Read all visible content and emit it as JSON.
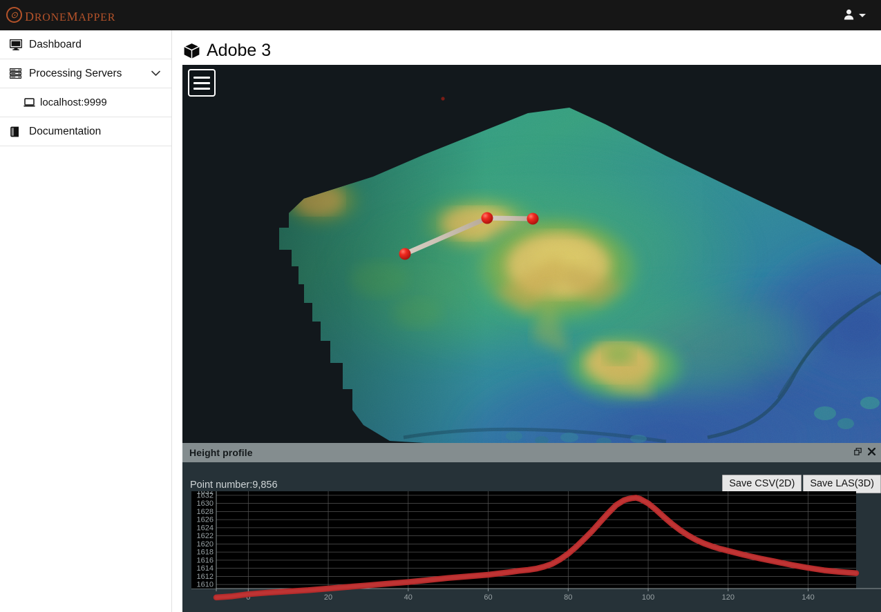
{
  "app": {
    "brand_name": "DroneMapper",
    "brand_color": "#b5532a",
    "logo_icon": "drone-swirl-icon"
  },
  "topbar": {
    "user_icon": "user-icon",
    "caret_icon": "chevron-down-icon"
  },
  "sidebar": {
    "items": [
      {
        "label": "Dashboard",
        "icon": "desktop-monitor-icon",
        "sub": false,
        "chevron": ""
      },
      {
        "label": "Processing Servers",
        "icon": "server-stack-icon",
        "sub": false,
        "chevron": "chevron-down-icon"
      },
      {
        "label": "localhost:9999",
        "icon": "laptop-icon",
        "sub": true,
        "chevron": ""
      },
      {
        "label": "Documentation",
        "icon": "book-icon",
        "sub": false,
        "chevron": ""
      }
    ]
  },
  "main": {
    "page_title": "Adobe 3",
    "page_title_icon": "cube-icon"
  },
  "viewer": {
    "menu_icon": "hamburger-menu-icon",
    "background_color": "#12181c",
    "measurement_marker_color": "#e02020",
    "measurement_markers": 3
  },
  "profile_panel": {
    "title": "Height profile",
    "restore_icon": "restore-window-icon",
    "close_icon": "close-icon",
    "point_number_label": "Point number:9,856",
    "buttons": [
      {
        "label": "Save CSV(2D)",
        "name": "save-csv-2d-button"
      },
      {
        "label": "Save LAS(3D)",
        "name": "save-las-3d-button"
      }
    ]
  },
  "chart_data": {
    "type": "line",
    "title": "Height profile",
    "xlabel": "",
    "ylabel": "",
    "series_color": "#b52b2b",
    "background": "#000000",
    "grid": true,
    "xlim": [
      -8,
      152
    ],
    "ylim": [
      1609,
      1633
    ],
    "xticks": [
      0,
      20,
      40,
      60,
      80,
      100,
      120,
      140
    ],
    "yticks": [
      1610,
      1612,
      1614,
      1616,
      1618,
      1620,
      1622,
      1624,
      1626,
      1628,
      1630,
      1632
    ],
    "x": [
      -8,
      -4,
      0,
      5,
      10,
      15,
      20,
      25,
      30,
      35,
      40,
      45,
      50,
      55,
      60,
      65,
      68,
      70,
      72,
      74,
      76,
      78,
      80,
      82,
      84,
      86,
      88,
      90,
      92,
      94,
      95,
      96,
      97,
      98,
      100,
      102,
      104,
      106,
      108,
      110,
      112,
      114,
      116,
      118,
      120,
      124,
      128,
      132,
      136,
      140,
      144,
      148,
      152
    ],
    "y": [
      1606.8,
      1607.1,
      1607.6,
      1608.0,
      1608.3,
      1608.6,
      1609.0,
      1609.4,
      1609.8,
      1610.2,
      1610.6,
      1611.1,
      1611.6,
      1612.0,
      1612.4,
      1613.0,
      1613.4,
      1613.6,
      1613.9,
      1614.4,
      1615.1,
      1616.2,
      1617.6,
      1619.3,
      1621.2,
      1623.2,
      1625.4,
      1627.6,
      1629.6,
      1630.8,
      1631.1,
      1631.3,
      1631.4,
      1631.1,
      1630.0,
      1628.4,
      1626.6,
      1624.9,
      1623.4,
      1622.1,
      1621.0,
      1620.1,
      1619.4,
      1618.8,
      1618.3,
      1617.3,
      1616.4,
      1615.6,
      1614.8,
      1614.1,
      1613.5,
      1613.1,
      1612.8
    ]
  }
}
